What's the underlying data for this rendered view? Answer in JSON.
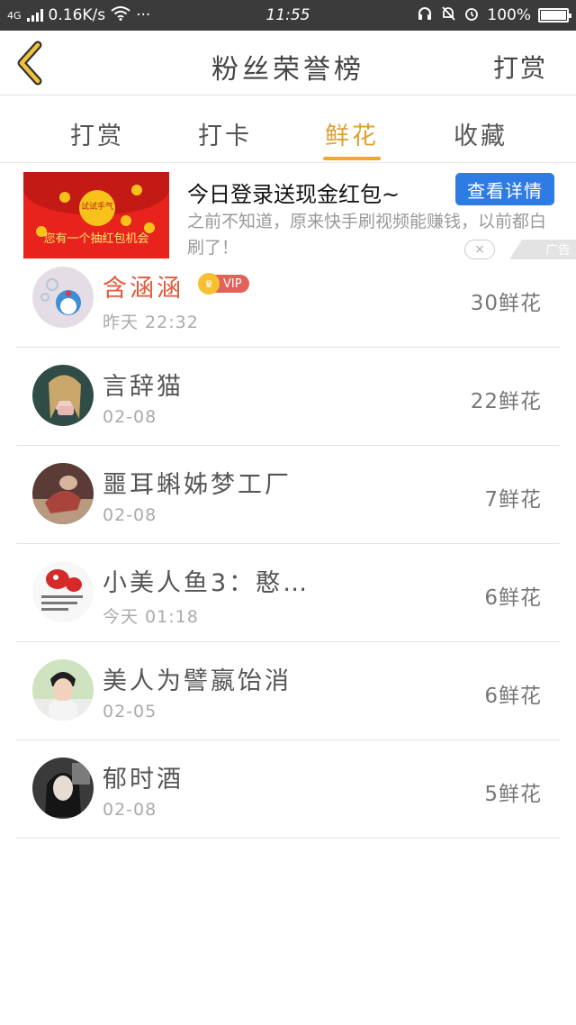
{
  "status_bar": {
    "network": "4G",
    "speed": "0.16K/s",
    "dots": "···",
    "time": "11:55",
    "battery": "100%"
  },
  "nav": {
    "title": "粉丝荣誉榜",
    "action": "打赏"
  },
  "tabs": [
    {
      "label": "打赏",
      "active": false
    },
    {
      "label": "打卡",
      "active": false
    },
    {
      "label": "鲜花",
      "active": true
    },
    {
      "label": "收藏",
      "active": false
    }
  ],
  "ad": {
    "image_seal": "试试手气",
    "image_caption": "您有一个抽红包机会",
    "title": "今日登录送现金红包~",
    "cta": "查看详情",
    "description": "之前不知道，原来快手刷视频能赚钱，以前都白刷了！",
    "close": "×",
    "badge": "广告"
  },
  "vip_label": "VIP",
  "items": [
    {
      "name": "含涵涵",
      "vip": true,
      "date": "昨天 22:32",
      "count": "30鲜花"
    },
    {
      "name": "言辞猫",
      "vip": false,
      "date": "02-08",
      "count": "22鲜花"
    },
    {
      "name": "噩耳蝌姊梦工厂",
      "vip": false,
      "date": "02-08",
      "count": "7鲜花"
    },
    {
      "name": "小美人鱼3：憨…",
      "vip": false,
      "date": "今天 01:18",
      "count": "6鲜花"
    },
    {
      "name": "美人为譬嬴饴消",
      "vip": false,
      "date": "02-05",
      "count": "6鲜花"
    },
    {
      "name": "郁时酒",
      "vip": false,
      "date": "02-08",
      "count": "5鲜花"
    }
  ],
  "colors": {
    "accent": "#f0a82a",
    "cta_blue": "#2f7be5",
    "vip_red": "#e25a3a",
    "status_bar": "#3b3b3b"
  }
}
